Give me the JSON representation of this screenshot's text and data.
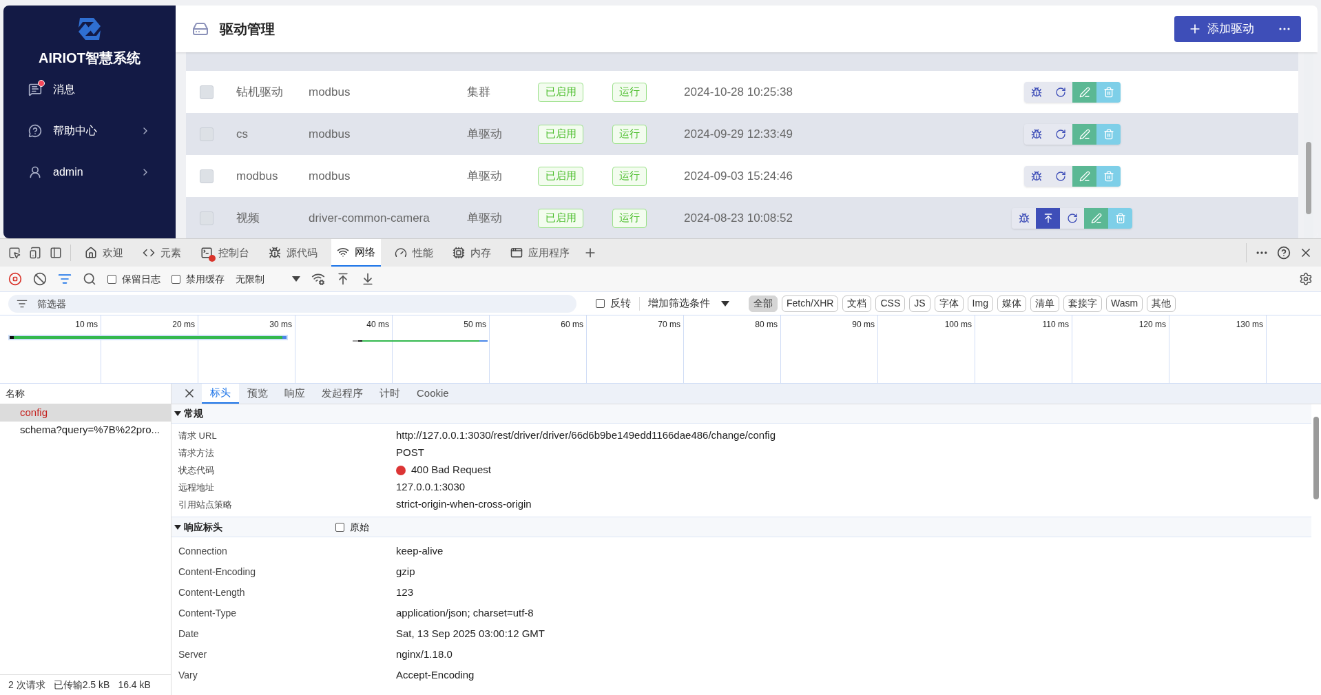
{
  "app": {
    "logo_text": "AIRIOT智慧系统",
    "page_title": "驱动管理",
    "add_button": "添加驱动",
    "nav": [
      {
        "kind": "message",
        "label": "消息",
        "unread": true,
        "arrow": false
      },
      {
        "kind": "help",
        "label": "帮助中心",
        "unread": false,
        "arrow": true
      },
      {
        "kind": "user",
        "label": "admin",
        "unread": false,
        "arrow": true
      }
    ],
    "rows": [
      {
        "name": "钻机驱动",
        "driver": "modbus",
        "type": "集群",
        "status": "已启用",
        "run": "运行",
        "time": "2024-10-28 10:25:38",
        "upload": false,
        "checked": false
      },
      {
        "name": "cs",
        "driver": "modbus",
        "type": "单驱动",
        "status": "已启用",
        "run": "运行",
        "time": "2024-09-29 12:33:49",
        "upload": false,
        "checked": false
      },
      {
        "name": "modbus",
        "driver": "modbus",
        "type": "单驱动",
        "status": "已启用",
        "run": "运行",
        "time": "2024-09-03 15:24:46",
        "upload": false,
        "checked": false
      },
      {
        "name": "视频",
        "driver": "driver-common-camera",
        "type": "单驱动",
        "status": "已启用",
        "run": "运行",
        "time": "2024-08-23 10:08:52",
        "upload": true,
        "checked": false
      }
    ]
  },
  "devtools": {
    "tabs": [
      {
        "kind": "home",
        "label": "欢迎",
        "selected": false
      },
      {
        "kind": "code",
        "label": "元素",
        "selected": false
      },
      {
        "kind": "console",
        "label": "控制台",
        "selected": false
      },
      {
        "kind": "bug",
        "label": "源代码",
        "selected": false
      },
      {
        "kind": "wifi",
        "label": "网络",
        "selected": true
      },
      {
        "kind": "gauge",
        "label": "性能",
        "selected": false
      },
      {
        "kind": "cpu",
        "label": "内存",
        "selected": false
      },
      {
        "kind": "window",
        "label": "应用程序",
        "selected": false
      }
    ],
    "toolbar": {
      "checks": [
        {
          "label": "保留日志",
          "checked": false
        },
        {
          "label": "禁用缓存",
          "checked": false
        }
      ],
      "throttle": "无限制"
    },
    "filter": {
      "placeholder": "筛选器",
      "invert": {
        "label": "反转",
        "checked": false
      },
      "more": "增加筛选条件",
      "chips": [
        {
          "label": "全部",
          "selected": true
        },
        {
          "label": "Fetch/XHR",
          "selected": false
        },
        {
          "label": "文档",
          "selected": false
        },
        {
          "label": "CSS",
          "selected": false
        },
        {
          "label": "JS",
          "selected": false
        },
        {
          "label": "字体",
          "selected": false
        },
        {
          "label": "Img",
          "selected": false
        },
        {
          "label": "媒体",
          "selected": false
        },
        {
          "label": "清单",
          "selected": false
        },
        {
          "label": "套接字",
          "selected": false
        },
        {
          "label": "Wasm",
          "selected": false
        },
        {
          "label": "其他",
          "selected": false
        }
      ]
    },
    "ticks": [
      "10 ms",
      "20 ms",
      "30 ms",
      "40 ms",
      "50 ms",
      "60 ms",
      "70 ms",
      "80 ms",
      "90 ms",
      "100 ms",
      "110 ms",
      "120 ms",
      "130 ms"
    ],
    "name_header": "名称",
    "requests": [
      {
        "name": "config",
        "selected": true,
        "error": true
      },
      {
        "name": "schema?query=%7B%22pro...",
        "selected": false,
        "error": false
      }
    ],
    "summary": [
      "2 次请求",
      "已传输2.5 kB",
      "16.4 kB"
    ],
    "detail_tabs": [
      {
        "label": "标头",
        "selected": true
      },
      {
        "label": "预览",
        "selected": false
      },
      {
        "label": "响应",
        "selected": false
      },
      {
        "label": "发起程序",
        "selected": false
      },
      {
        "label": "计时",
        "selected": false
      },
      {
        "label": "Cookie",
        "selected": false
      }
    ],
    "general": {
      "title": "常规",
      "expanded": true,
      "rows": [
        {
          "key": "请求 URL",
          "value": "http://127.0.0.1:3030/rest/driver/driver/66d6b9be149edd1166dae486/change/config",
          "error": false
        },
        {
          "key": "请求方法",
          "value": "POST",
          "error": false
        },
        {
          "key": "状态代码",
          "value": "400 Bad Request",
          "error": true
        },
        {
          "key": "远程地址",
          "value": "127.0.0.1:3030",
          "error": false
        },
        {
          "key": "引用站点策略",
          "value": "strict-origin-when-cross-origin",
          "error": false
        }
      ]
    },
    "response": {
      "title": "响应标头",
      "expanded": true,
      "raw": {
        "label": "原始",
        "checked": false
      },
      "rows": [
        {
          "key": "Connection",
          "value": "keep-alive"
        },
        {
          "key": "Content-Encoding",
          "value": "gzip"
        },
        {
          "key": "Content-Length",
          "value": "123"
        },
        {
          "key": "Content-Type",
          "value": "application/json; charset=utf-8"
        },
        {
          "key": "Date",
          "value": "Sat, 13 Sep 2025 03:00:12 GMT"
        },
        {
          "key": "Server",
          "value": "nginx/1.18.0"
        },
        {
          "key": "Vary",
          "value": "Accept-Encoding"
        }
      ]
    }
  }
}
